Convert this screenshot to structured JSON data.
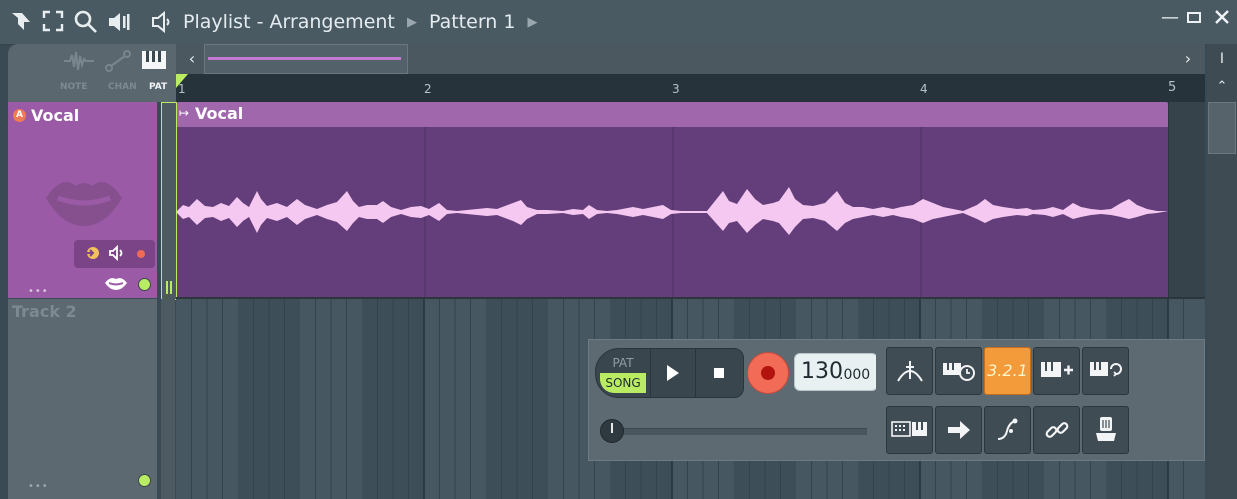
{
  "titlebar": {
    "window_title": "Playlist - Arrangement",
    "pattern": "Pattern 1",
    "icons": [
      "snap-icon",
      "fullscreen-icon",
      "zoom-icon",
      "speaker-icon",
      "speaker-icon"
    ]
  },
  "mode_tabs": [
    {
      "label": "NOTE",
      "active": false
    },
    {
      "label": "CHAN",
      "active": false
    },
    {
      "label": "PAT",
      "active": true
    }
  ],
  "ruler": {
    "bars": [
      "1",
      "2",
      "3",
      "4",
      "5"
    ]
  },
  "tracks": [
    {
      "name": "Vocal",
      "clip_label": "Vocal"
    },
    {
      "name": "Track 2"
    }
  ],
  "transport": {
    "pat_label": "PAT",
    "song_label": "SONG",
    "tempo_main": "130",
    "tempo_frac": ".000",
    "lcd_text": "3.2.1"
  },
  "colors": {
    "accent_green": "#b9ec63",
    "vocal_clip": "#633e7a",
    "record_red": "#e8372f"
  }
}
